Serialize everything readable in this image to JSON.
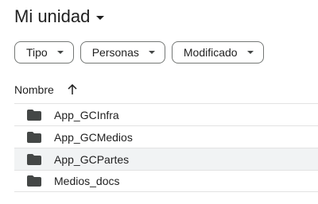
{
  "header": {
    "title": "Mi unidad"
  },
  "filters": [
    {
      "label": "Tipo"
    },
    {
      "label": "Personas"
    },
    {
      "label": "Modificado"
    }
  ],
  "columns": {
    "name_label": "Nombre"
  },
  "files": [
    {
      "name": "App_GCInfra",
      "icon": "folder-icon"
    },
    {
      "name": "App_GCMedios",
      "icon": "folder-icon"
    },
    {
      "name": "App_GCPartes",
      "icon": "folder-icon"
    },
    {
      "name": "Medios_docs",
      "icon": "folder-icon"
    }
  ],
  "colors": {
    "text": "#1f1f1f",
    "border": "#747775",
    "divider": "#e3e3e3",
    "hover": "#f1f3f4"
  }
}
